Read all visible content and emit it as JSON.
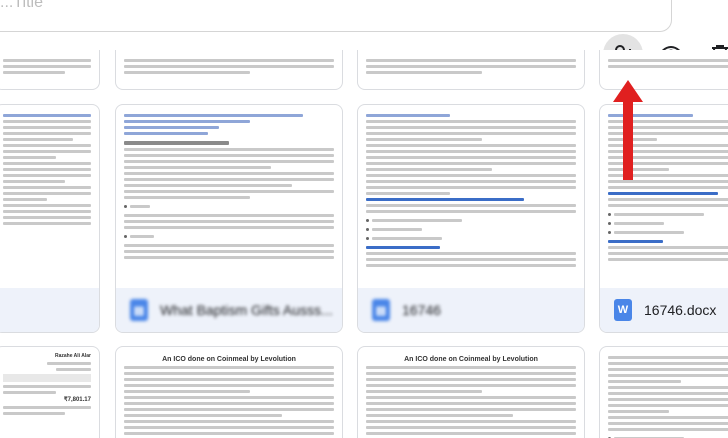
{
  "header": {
    "title": "...Title"
  },
  "actions": {
    "share_icon": "person-add-icon",
    "preview_icon": "eye-icon",
    "delete_icon": "trash-icon"
  },
  "annotation": {
    "color": "#e02020"
  },
  "files": [
    {
      "name": "",
      "blurred": true
    },
    {
      "name": "What Baptism Gifts Ausss...",
      "blurred": true
    },
    {
      "name": "16746",
      "blurred": true
    },
    {
      "name": "16746.docx",
      "blurred": false,
      "icon_letter": "W"
    }
  ],
  "docs": {
    "doc2_link1": "http://www.councilofchurches.org/baptismgifts",
    "doc2_heading": "Topic: Baptism gifts for your Dear Ones",
    "doc2_bullet1": "Bible",
    "doc2_bullet2": "Clothes",
    "doc3_subhead": "Why P2P Exchanges Thrive over Centralized Platforms",
    "doc3_bullet1": "Considerably higher accessibility to fiat",
    "doc3_bullet2": "Revenue stream",
    "doc3_bullet3": "Straightforward and intuitive",
    "doc3_subhead2": "Hello! How is Your Fat",
    "doc4_subhead": "Why P2P Exchanges Thrive over Centralized Pl",
    "doc4_bullet1": "Considerably higher accessibility to fiat",
    "doc4_bullet2": "Revenue stream",
    "doc4_bullet3": "Straightforward and intuitive",
    "doc4_subhead2": "Hello! How is Your Fat",
    "ico_title_a": "An ICO done on Coinmeal by Levolution",
    "ico_title_b": "An ICO done on Coinmeal by Levolution",
    "invoice_name": "Razahe Ali Alar",
    "invoice_amount": "₹7,801.17"
  }
}
